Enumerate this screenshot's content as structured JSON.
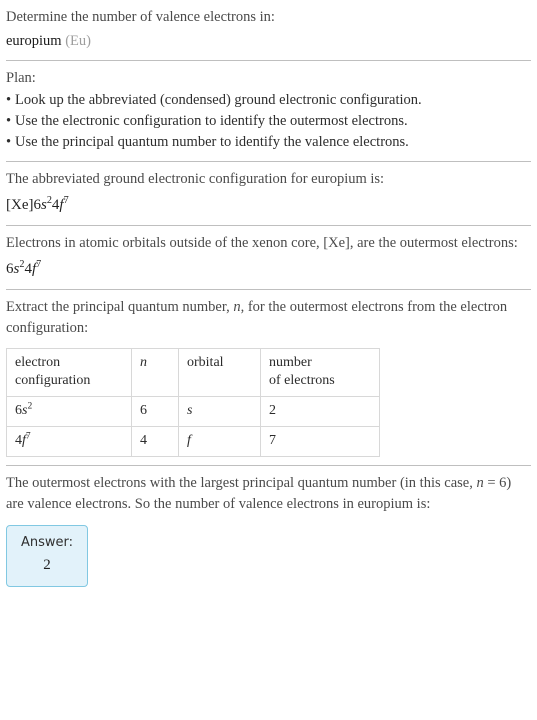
{
  "header": {
    "prompt": "Determine the number of valence electrons in:",
    "subject_name": "europium",
    "subject_symbol": "(Eu)"
  },
  "plan": {
    "label": "Plan:",
    "bullet_marker": "•",
    "items": [
      "Look up the abbreviated (condensed) ground electronic configuration.",
      "Use the electronic configuration to identify the outermost electrons.",
      "Use the principal quantum number to identify the valence electrons."
    ]
  },
  "config_section": {
    "text": "The abbreviated ground electronic configuration for europium is:",
    "formula": {
      "core": "[Xe]",
      "terms": [
        {
          "n": "6",
          "orbital": "s",
          "count": "2"
        },
        {
          "n": "4",
          "orbital": "f",
          "count": "7"
        }
      ]
    }
  },
  "outermost_section": {
    "text": "Electrons in atomic orbitals outside of the xenon core, [Xe], are the outermost electrons:",
    "formula": {
      "core": "",
      "terms": [
        {
          "n": "6",
          "orbital": "s",
          "count": "2"
        },
        {
          "n": "4",
          "orbital": "f",
          "count": "7"
        }
      ]
    }
  },
  "extract_section": {
    "text_before_n": "Extract the principal quantum number, ",
    "n_symbol": "n",
    "text_after_n": ", for the outermost electrons from the electron configuration:",
    "table": {
      "headers": {
        "configuration_line1": "electron",
        "configuration_line2": "configuration",
        "n": "n",
        "orbital": "orbital",
        "electrons_line1": "number",
        "electrons_line2": "of electrons"
      },
      "rows": [
        {
          "n_value": "6",
          "orbital": "s",
          "electrons": "2",
          "cfg_n": "6",
          "cfg_orbital": "s",
          "cfg_sup": "2"
        },
        {
          "n_value": "4",
          "orbital": "f",
          "electrons": "7",
          "cfg_n": "4",
          "cfg_orbital": "f",
          "cfg_sup": "7"
        }
      ]
    }
  },
  "conclusion": {
    "part1": "The outermost electrons with the largest principal quantum number (in this case,",
    "n_symbol": "n",
    "part2": " = 6) are valence electrons. So the number of valence electrons in europium is:"
  },
  "answer": {
    "label": "Answer:",
    "value": "2",
    "box_background": "#e2f2fa",
    "box_border": "#81c8e2"
  }
}
